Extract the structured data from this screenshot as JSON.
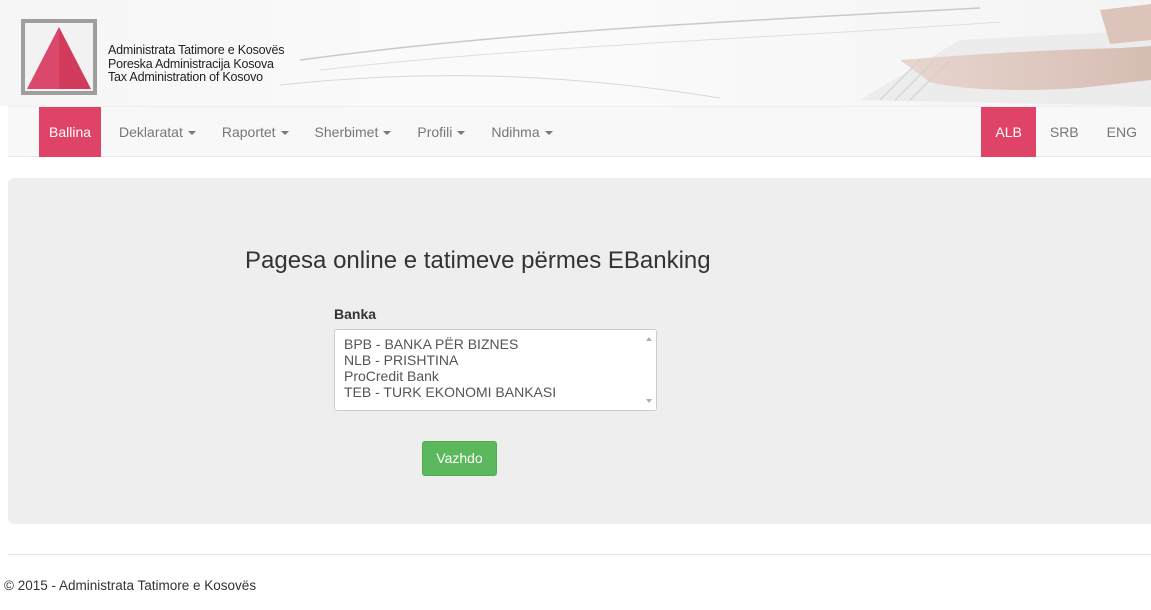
{
  "header": {
    "org_names": [
      "Administrata Tatimore e Kosovës",
      "Poreska Administracija Kosova",
      "Tax Administration of Kosovo"
    ],
    "logo_icon": "triangle-logo-icon",
    "colors": {
      "accent": "#e04368",
      "logo_frame": "#9e9e9e"
    }
  },
  "nav": {
    "items": [
      {
        "label": "Ballina",
        "active": true,
        "dropdown": false
      },
      {
        "label": "Deklaratat",
        "active": false,
        "dropdown": true
      },
      {
        "label": "Raportet",
        "active": false,
        "dropdown": true
      },
      {
        "label": "Sherbimet",
        "active": false,
        "dropdown": true
      },
      {
        "label": "Profili",
        "active": false,
        "dropdown": true
      },
      {
        "label": "Ndihma",
        "active": false,
        "dropdown": true
      }
    ],
    "languages": [
      {
        "label": "ALB",
        "active": true
      },
      {
        "label": "SRB",
        "active": false
      },
      {
        "label": "ENG",
        "active": false
      }
    ]
  },
  "main": {
    "title": "Pagesa online e tatimeve përmes EBanking",
    "bank_label": "Banka",
    "bank_options": [
      "BPB - BANKA PËR BIZNES",
      "NLB - PRISHTINA",
      "ProCredit Bank",
      "TEB - TURK EKONOMI BANKASI"
    ],
    "submit_label": "Vazhdo",
    "colors": {
      "button": "#5cb85c",
      "panel": "#eeeeee"
    }
  },
  "footer": {
    "text": "© 2015 - Administrata Tatimore e Kosovës"
  }
}
